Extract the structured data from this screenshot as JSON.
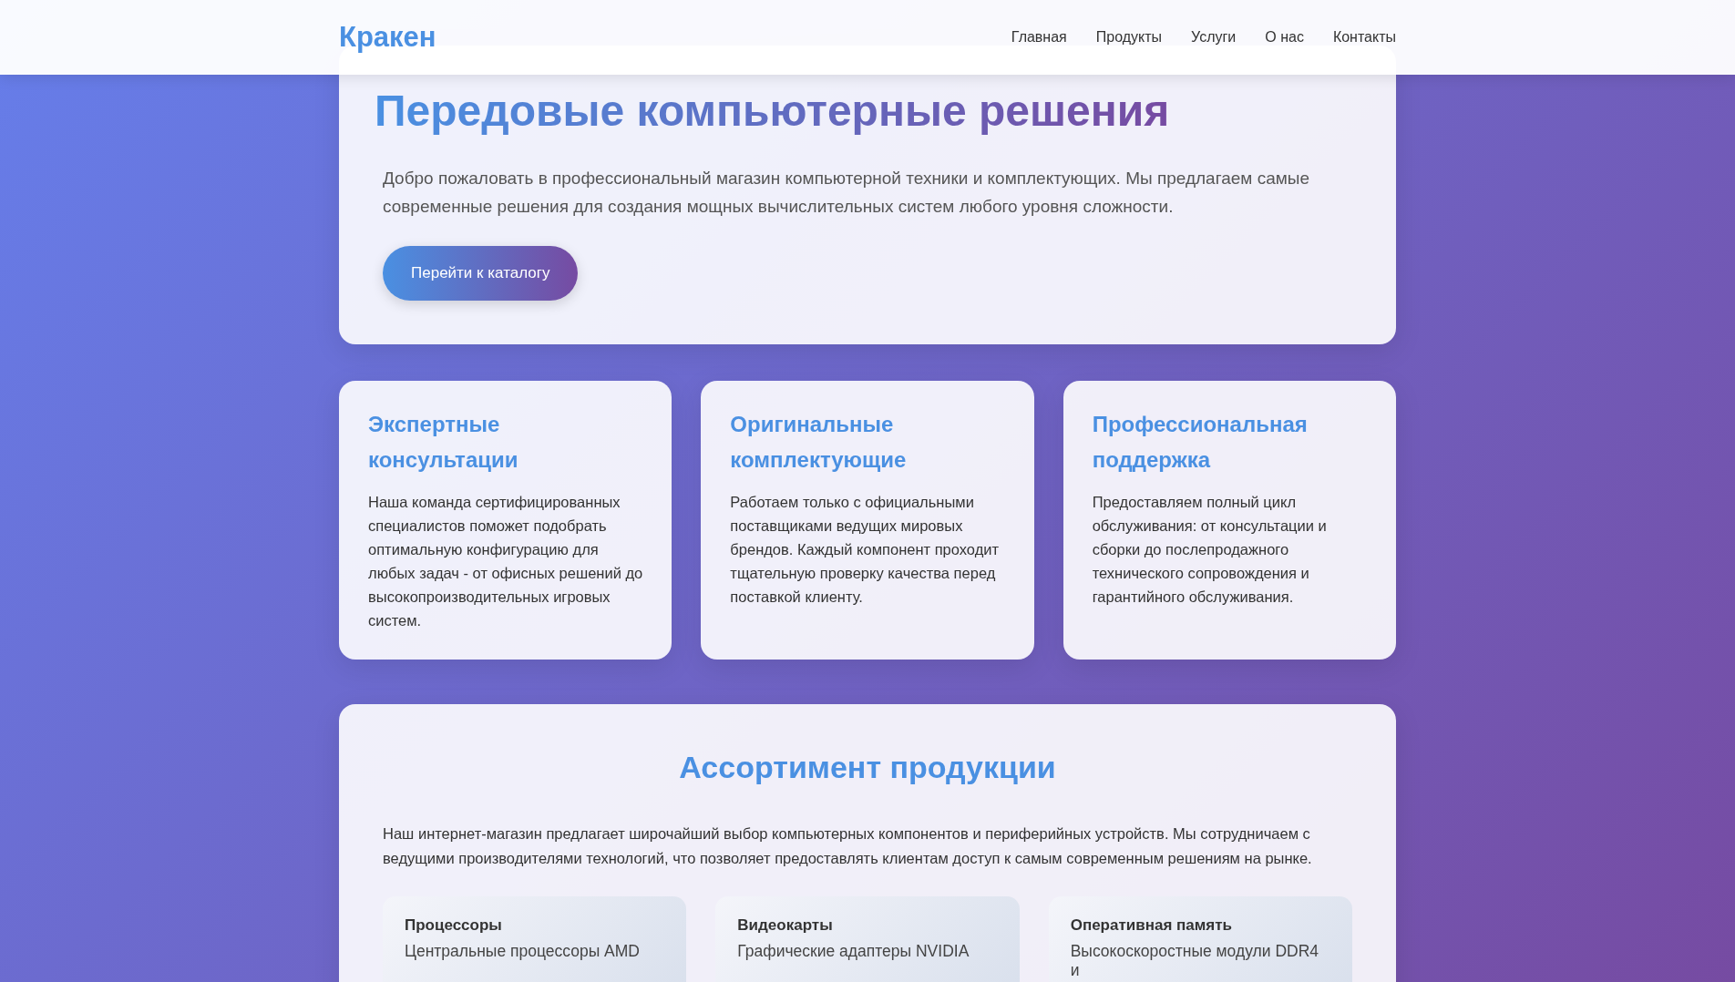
{
  "header": {
    "logo": "Кракен",
    "nav": [
      {
        "label": "Главная"
      },
      {
        "label": "Продукты"
      },
      {
        "label": "Услуги"
      },
      {
        "label": "О нас"
      },
      {
        "label": "Контакты"
      }
    ]
  },
  "hero": {
    "title": "Передовые компьютерные решения",
    "text": "Добро пожаловать в профессиональный магазин компьютерной техники и комплектующих. Мы предлагаем самые современные решения для создания мощных вычислительных систем любого уровня сложности.",
    "button": "Перейти к каталогу"
  },
  "features": [
    {
      "title": "Экспертные консультации",
      "text": "Наша команда сертифицированных специалистов поможет подобрать оптимальную конфигурацию для любых задач - от офисных решений до высокопроизводительных игровых систем."
    },
    {
      "title": "Оригинальные комплектующие",
      "text": "Работаем только с официальными поставщиками ведущих мировых брендов. Каждый компонент проходит тщательную проверку качества перед поставкой клиенту."
    },
    {
      "title": "Профессиональная поддержка",
      "text": "Предоставляем полный цикл обслуживания: от консультации и сборки до послепродажного технического сопровождения и гарантийного обслуживания."
    }
  ],
  "assortment": {
    "title": "Ассортимент продукции",
    "text": "Наш интернет-магазин предлагает широчайший выбор компьютерных компонентов и периферийных устройств. Мы сотрудничаем с ведущими производителями технологий, что позволяет предоставлять клиентам доступ к самым современным решениям на рынке.",
    "products": [
      {
        "title": "Процессоры",
        "text": "Центральные процессоры AMD"
      },
      {
        "title": "Видеокарты",
        "text": "Графические адаптеры NVIDIA"
      },
      {
        "title": "Оперативная память",
        "text": "Высокоскоростные модули DDR4 и"
      }
    ]
  }
}
